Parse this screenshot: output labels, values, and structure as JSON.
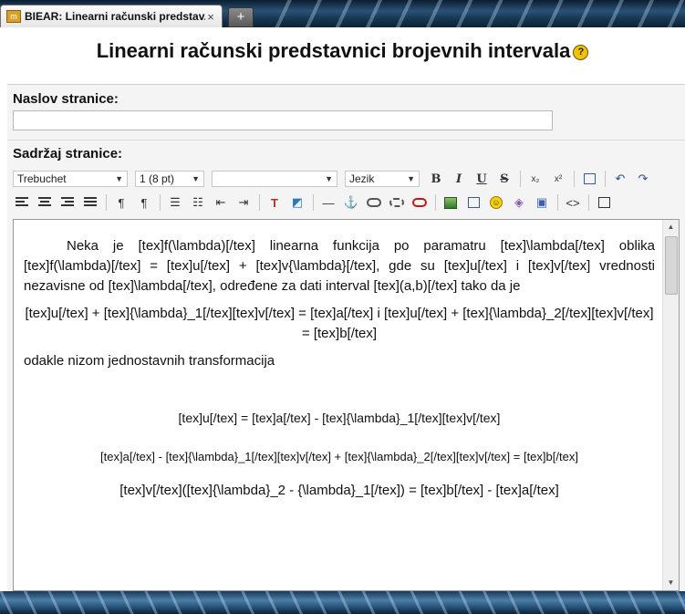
{
  "browser": {
    "tab_title": "BIEAR: Linearni računski predstav...",
    "tab_close": "×",
    "new_tab": "+"
  },
  "page": {
    "title": "Linearni računski predstavnici brojevnih intervala",
    "help_icon": "?"
  },
  "form": {
    "title_label": "Naslov stranice:",
    "title_value": "",
    "content_label": "Sadržaj stranice:"
  },
  "toolbar": {
    "font_family": "Trebuchet",
    "font_size": "1 (8 pt)",
    "format": "",
    "language": "Jezik",
    "bold": "B",
    "italic": "I",
    "underline": "U",
    "strike": "S",
    "subscript": "x₂",
    "superscript": "x²",
    "html": "<>"
  },
  "editor": {
    "p1": "Neka je [tex]f(\\lambda)[/tex] linearna funkcija po paramatru [tex]\\lambda[/tex] oblika [tex]f(\\lambda)[/tex] = [tex]u[/tex] + [tex]v{\\lambda}[/tex], gde su [tex]u[/tex] i [tex]v[/tex] vrednosti nezavisne od [tex]\\lambda[/tex], određene za dati interval [tex](a,b)[/tex] tako da je",
    "p2": "[tex]u[/tex] + [tex]{\\lambda}_1[/tex][tex]v[/tex] = [tex]a[/tex] i [tex]u[/tex] + [tex]{\\lambda}_2[/tex][tex]v[/tex] = [tex]b[/tex]",
    "p3": "odakle nizom jednostavnih transformacija",
    "p4": "[tex]u[/tex] = [tex]a[/tex] - [tex]{\\lambda}_1[/tex][tex]v[/tex]",
    "p5": "[tex]a[/tex] - [tex]{\\lambda}_1[/tex][tex]v[/tex] + [tex]{\\lambda}_2[/tex][tex]v[/tex] = [tex]b[/tex]",
    "p6": "[tex]v[/tex]([tex]{\\lambda}_2 - {\\lambda}_1[/tex]) = [tex]b[/tex] - [tex]a[/tex]"
  },
  "icons": {
    "tab_favicon": "bear-icon",
    "undo": "undo-icon",
    "redo": "redo-icon",
    "anchor": "anchor-icon",
    "smiley": "smiley-icon"
  }
}
